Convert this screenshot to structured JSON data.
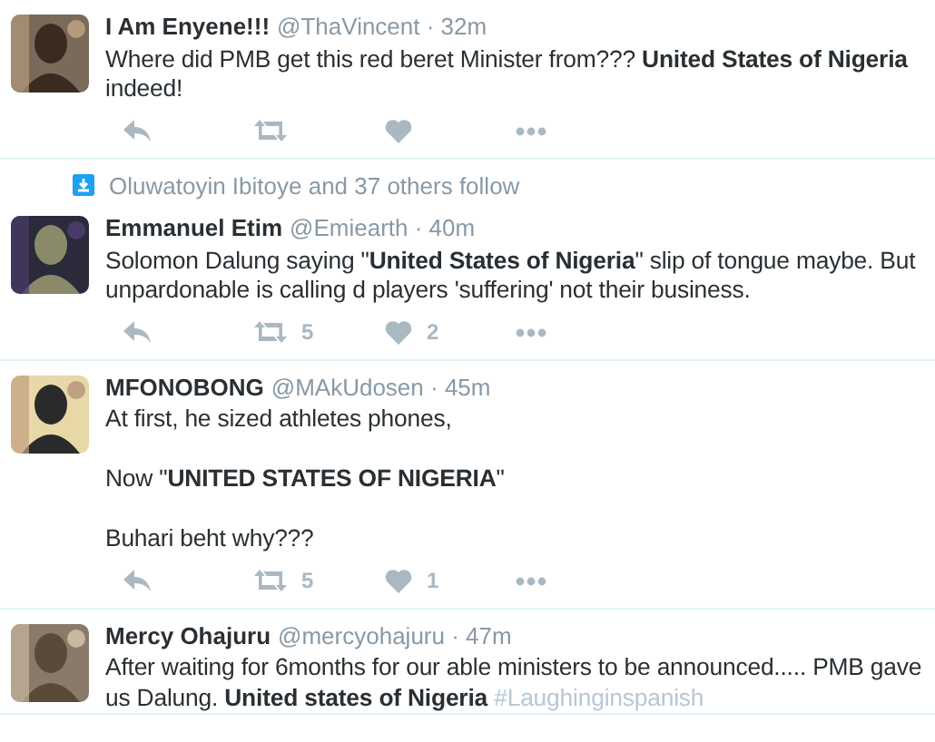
{
  "tweets": [
    {
      "name": "I Am Enyene!!!",
      "handle": "@ThaVincent",
      "time": "· 32m",
      "text": "Where did PMB get this red beret Minister from??? **United States of Nigeria** indeed!"
    },
    {
      "context": "Oluwatoyin Ibitoye and 37 others follow",
      "name": "Emmanuel Etim",
      "handle": "@Emiearth",
      "time": "· 40m",
      "text": "Solomon Dalung saying \"**United States of Nigeria**\" slip of tongue maybe. But unpardonable is calling d players 'suffering' not their business.",
      "actions": {
        "retweets": "5",
        "likes": "2"
      }
    },
    {
      "name": "MFONOBONG",
      "handle": "@MAkUdosen",
      "time": "· 45m",
      "text": "At first, he sized athletes phones,\n\nNow \"**UNITED STATES OF NIGERIA**\"\n\nBuhari beht why???",
      "actions": {
        "retweets": "5",
        "likes": "1"
      }
    },
    {
      "name": "Mercy Ohajuru",
      "handle": "@mercyohajuru",
      "time": "· 47m",
      "text": "After waiting for 6months for our able ministers to be announced..... PMB gave us Dalung. **United states of Nigeria**",
      "hashtag": "#Laughinginspanish"
    }
  ]
}
